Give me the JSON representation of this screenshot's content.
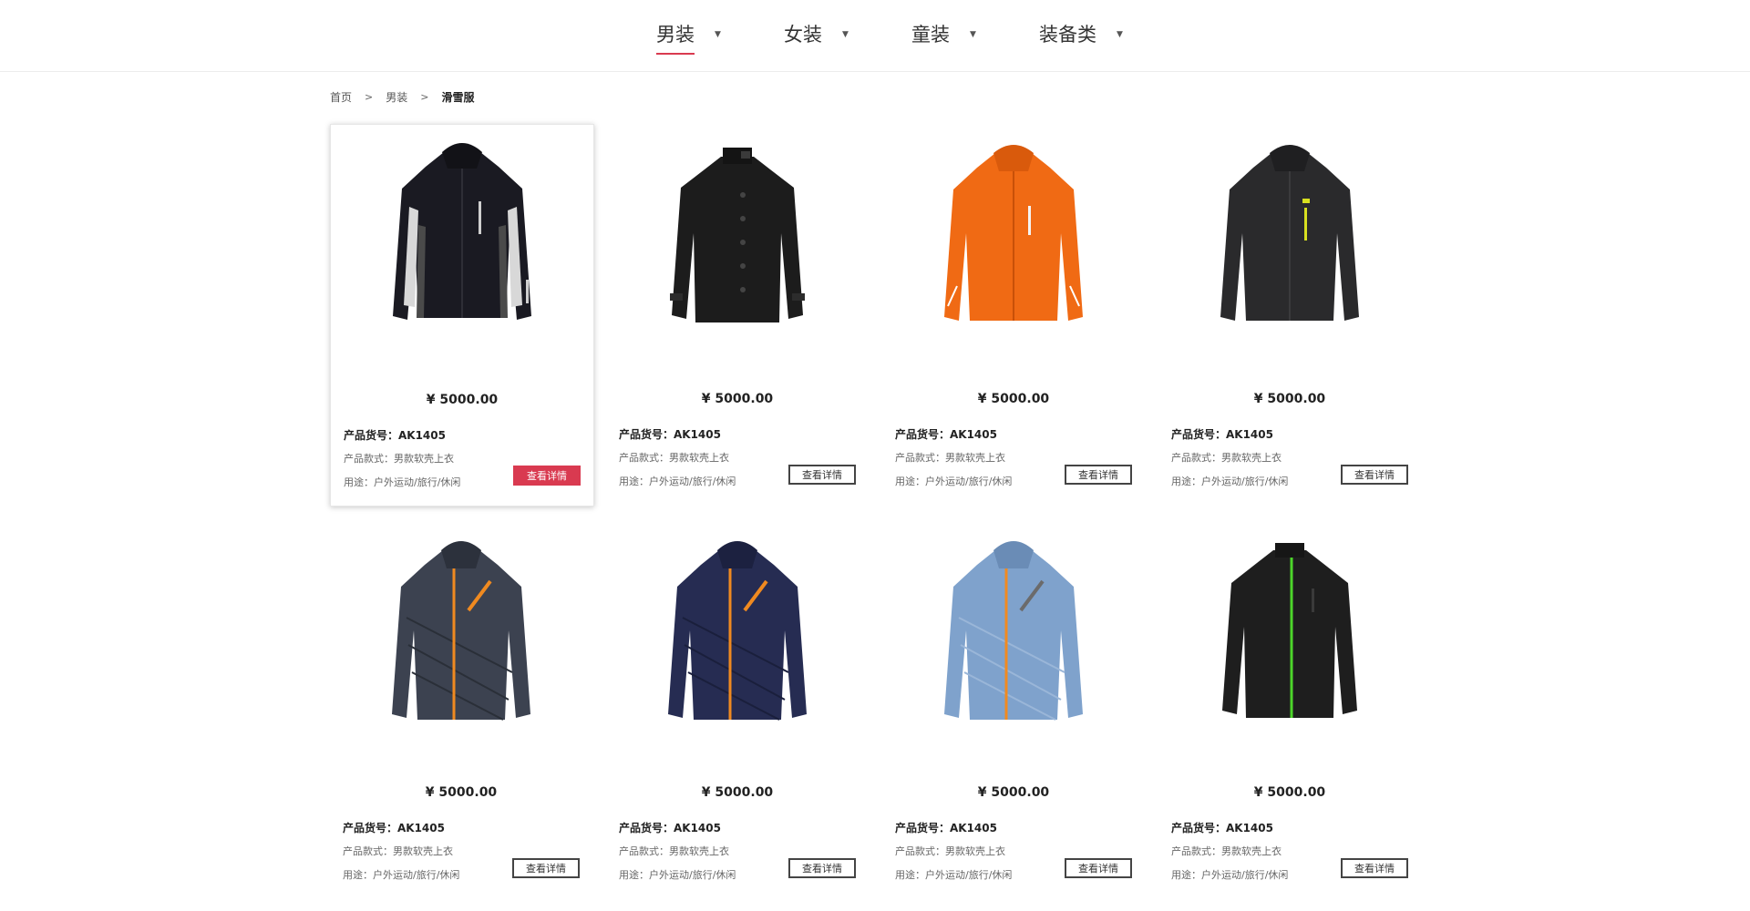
{
  "nav": {
    "items": [
      {
        "label": "男装",
        "active": true
      },
      {
        "label": "女装",
        "active": false
      },
      {
        "label": "童装",
        "active": false
      },
      {
        "label": "装备类",
        "active": false
      }
    ],
    "caret": "▼"
  },
  "breadcrumb": {
    "items": [
      "首页",
      "男装",
      "滑雪服"
    ],
    "separator": ">"
  },
  "colors": {
    "accent": "#d93a50",
    "jackets": [
      "#1a1a22",
      "#1c1c1c",
      "#f06a14",
      "#2a2a2c",
      "#3c4250",
      "#262c52",
      "#7fa2cc",
      "#1e1e1e"
    ]
  },
  "products": [
    {
      "price": "¥ 5000.00",
      "sku": "产品货号：AK1405",
      "style": "产品款式：男款软壳上衣",
      "usage": "用途：户外运动/旅行/休闲",
      "button": "查看详情",
      "image": "black-ski-jacket-hooded"
    },
    {
      "price": "¥ 5000.00",
      "sku": "产品货号：AK1405",
      "style": "产品款式：男款软壳上衣",
      "usage": "用途：户外运动/旅行/休闲",
      "button": "查看详情",
      "image": "black-button-coat"
    },
    {
      "price": "¥ 5000.00",
      "sku": "产品货号：AK1405",
      "style": "产品款式：男款软壳上衣",
      "usage": "用途：户外运动/旅行/休闲",
      "button": "查看详情",
      "image": "orange-ski-jacket"
    },
    {
      "price": "¥ 5000.00",
      "sku": "产品货号：AK1405",
      "style": "产品款式：男款软壳上衣",
      "usage": "用途：户外运动/旅行/休闲",
      "button": "查看详情",
      "image": "dark-grey-ski-jacket"
    },
    {
      "price": "¥ 5000.00",
      "sku": "产品货号：AK1405",
      "style": "产品款式：男款软壳上衣",
      "usage": "用途：户外运动/旅行/休闲",
      "button": "查看详情",
      "image": "grey-down-jacket"
    },
    {
      "price": "¥ 5000.00",
      "sku": "产品货号：AK1405",
      "style": "产品款式：男款软壳上衣",
      "usage": "用途：户外运动/旅行/休闲",
      "button": "查看详情",
      "image": "navy-down-jacket"
    },
    {
      "price": "¥ 5000.00",
      "sku": "产品货号：AK1405",
      "style": "产品款式：男款软壳上衣",
      "usage": "用途：户外运动/旅行/休闲",
      "button": "查看详情",
      "image": "light-blue-down-jacket"
    },
    {
      "price": "¥ 5000.00",
      "sku": "产品货号：AK1405",
      "style": "产品款式：男款软壳上衣",
      "usage": "用途：户外运动/旅行/休闲",
      "button": "查看详情",
      "image": "black-softshell-jacket"
    }
  ]
}
